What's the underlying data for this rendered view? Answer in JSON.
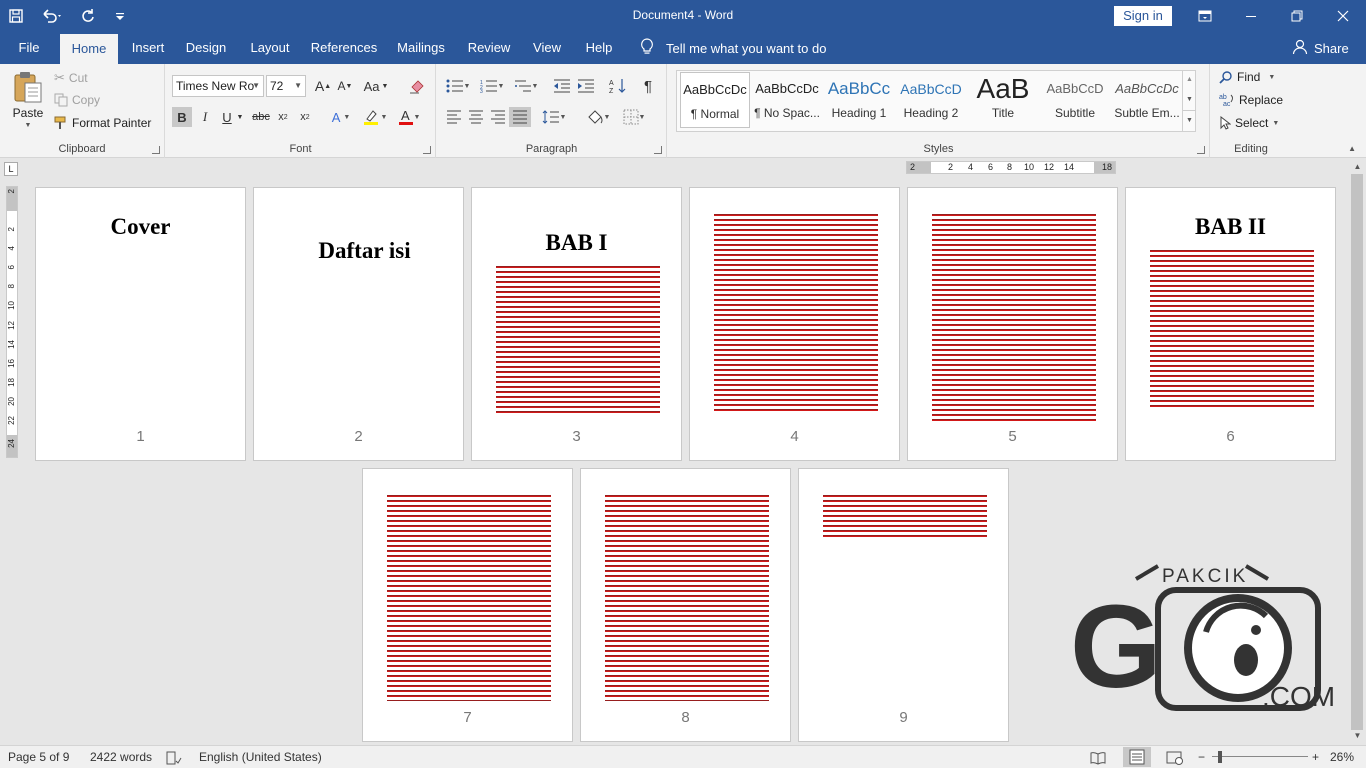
{
  "window": {
    "title": "Document4 - Word",
    "sign_in": "Sign in"
  },
  "tabs": [
    "File",
    "Home",
    "Insert",
    "Design",
    "Layout",
    "References",
    "Mailings",
    "Review",
    "View",
    "Help"
  ],
  "tell_me": "Tell me what you want to do",
  "share": "Share",
  "clipboard": {
    "paste": "Paste",
    "cut": "Cut",
    "copy": "Copy",
    "format_painter": "Format Painter",
    "label": "Clipboard"
  },
  "font": {
    "name": "Times New Ro",
    "size": "72",
    "label": "Font",
    "change_case": "Aa",
    "grow": "A",
    "shrink": "A"
  },
  "paragraph": {
    "label": "Paragraph"
  },
  "styles": {
    "label": "Styles",
    "items": [
      {
        "preview": "AaBbCcDc",
        "name": "¶ Normal"
      },
      {
        "preview": "AaBbCcDc",
        "name": "¶ No Spac..."
      },
      {
        "preview": "AaBbCc",
        "name": "Heading 1"
      },
      {
        "preview": "AaBbCcD",
        "name": "Heading 2"
      },
      {
        "preview": "AaB",
        "name": "Title"
      },
      {
        "preview": "AaBbCcD",
        "name": "Subtitle"
      },
      {
        "preview": "AaBbCcDc",
        "name": "Subtle Em..."
      }
    ]
  },
  "editing": {
    "label": "Editing",
    "find": "Find",
    "replace": "Replace",
    "select": "Select"
  },
  "ruler": {
    "h": [
      "2",
      "2",
      "4",
      "6",
      "8",
      "10",
      "12",
      "14",
      "18"
    ],
    "v": [
      "2",
      "2",
      "4",
      "6",
      "8",
      "10",
      "12",
      "14",
      "16",
      "18",
      "20",
      "22",
      "24"
    ]
  },
  "pages": [
    {
      "num": "1",
      "title": "Cover"
    },
    {
      "num": "2",
      "title": "Daftar isi"
    },
    {
      "num": "3",
      "title": "BAB I"
    },
    {
      "num": "4",
      "title": ""
    },
    {
      "num": "5",
      "title": ""
    },
    {
      "num": "6",
      "title": "BAB II"
    },
    {
      "num": "7",
      "title": ""
    },
    {
      "num": "8",
      "title": ""
    },
    {
      "num": "9",
      "title": ""
    }
  ],
  "watermark": {
    "top": "PAKCIK",
    "bottom": ".COM",
    "letter": "G"
  },
  "status": {
    "page": "Page 5 of 9",
    "words": "2422 words",
    "language": "English (United States)",
    "zoom": "26%",
    "minus": "−",
    "plus": "+"
  },
  "colors": {
    "brand": "#2b579a",
    "ribbon": "#f3f3f3",
    "squiggle": "#d21919"
  }
}
